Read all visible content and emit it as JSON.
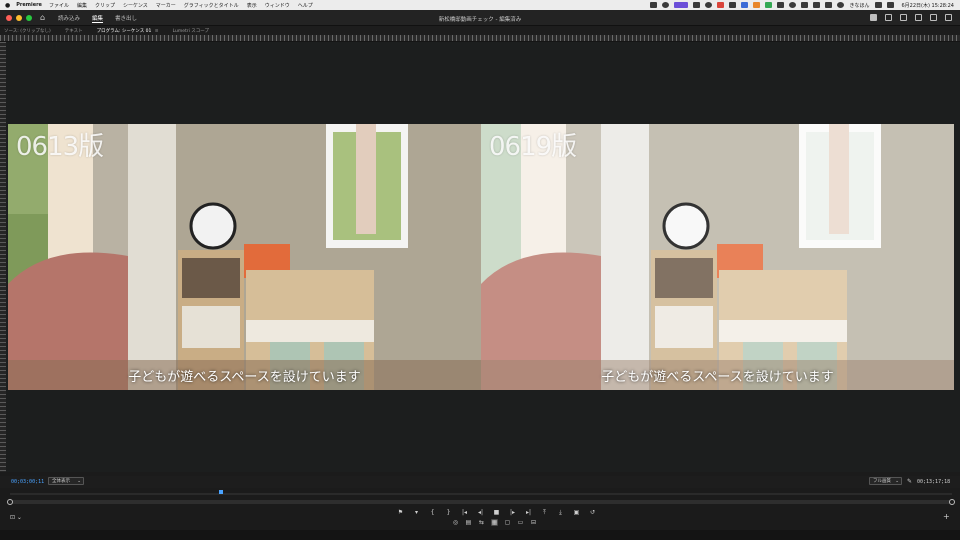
{
  "menubar": {
    "app_name": "Premiere",
    "items": [
      "ファイル",
      "編集",
      "クリップ",
      "シーケンス",
      "マーカー",
      "グラフィックとタイトル",
      "表示",
      "ウィンドウ",
      "ヘルプ"
    ],
    "user_label": "きなほん",
    "clock": "6月22日(木)  15:28:24"
  },
  "header": {
    "workspaces": [
      "読み込み",
      "編集",
      "書き出し"
    ],
    "active_workspace": "編集",
    "document_title": "新松橋邸動画チェック - 編集済み"
  },
  "panels": {
    "source_tab": "ソース: (クリップなし)",
    "text_tab": "テキスト",
    "program_tab": "プログラム: シーケンス 01",
    "program_menu": "≡",
    "lumetri_tab": "Lumetri スコープ"
  },
  "viewer": {
    "left": {
      "version_label": "0613版",
      "subtitle": "子どもが遊べるスペースを設けています"
    },
    "right": {
      "version_label": "0619版",
      "subtitle": "子どもが遊べるスペースを設けています"
    },
    "cursor_color": "#35c930"
  },
  "monitor_bar": {
    "timecode_current": "00;03;00;11",
    "fit_value": "全体表示",
    "quality_value": "フル画質",
    "timecode_duration": "00;13;17;18"
  },
  "transport": {
    "row1_icons": [
      "marker-icon",
      "marker-down-icon",
      "in-point-icon",
      "out-point-icon",
      "go-to-in-icon",
      "step-back-icon",
      "stop-icon",
      "step-forward-icon",
      "go-to-out-icon",
      "lift-icon",
      "extract-icon",
      "export-frame-icon",
      "loop-icon"
    ],
    "row1_glyphs": [
      "⚑",
      "▾",
      "{",
      "}",
      "|◂",
      "◂|",
      "■",
      "|▸",
      "▸|",
      "⤒",
      "⤓",
      "▣",
      "↺"
    ],
    "row2_glyphs": [
      "◎",
      "▤",
      "⇆",
      "▦",
      "▢",
      "▭",
      "⊟"
    ],
    "add_glyph": "+",
    "left_tool_glyph": "⊡ ⌄"
  },
  "colors": {
    "accent_blue": "#4aa3ff",
    "panel_bg": "#1c1e1e"
  }
}
